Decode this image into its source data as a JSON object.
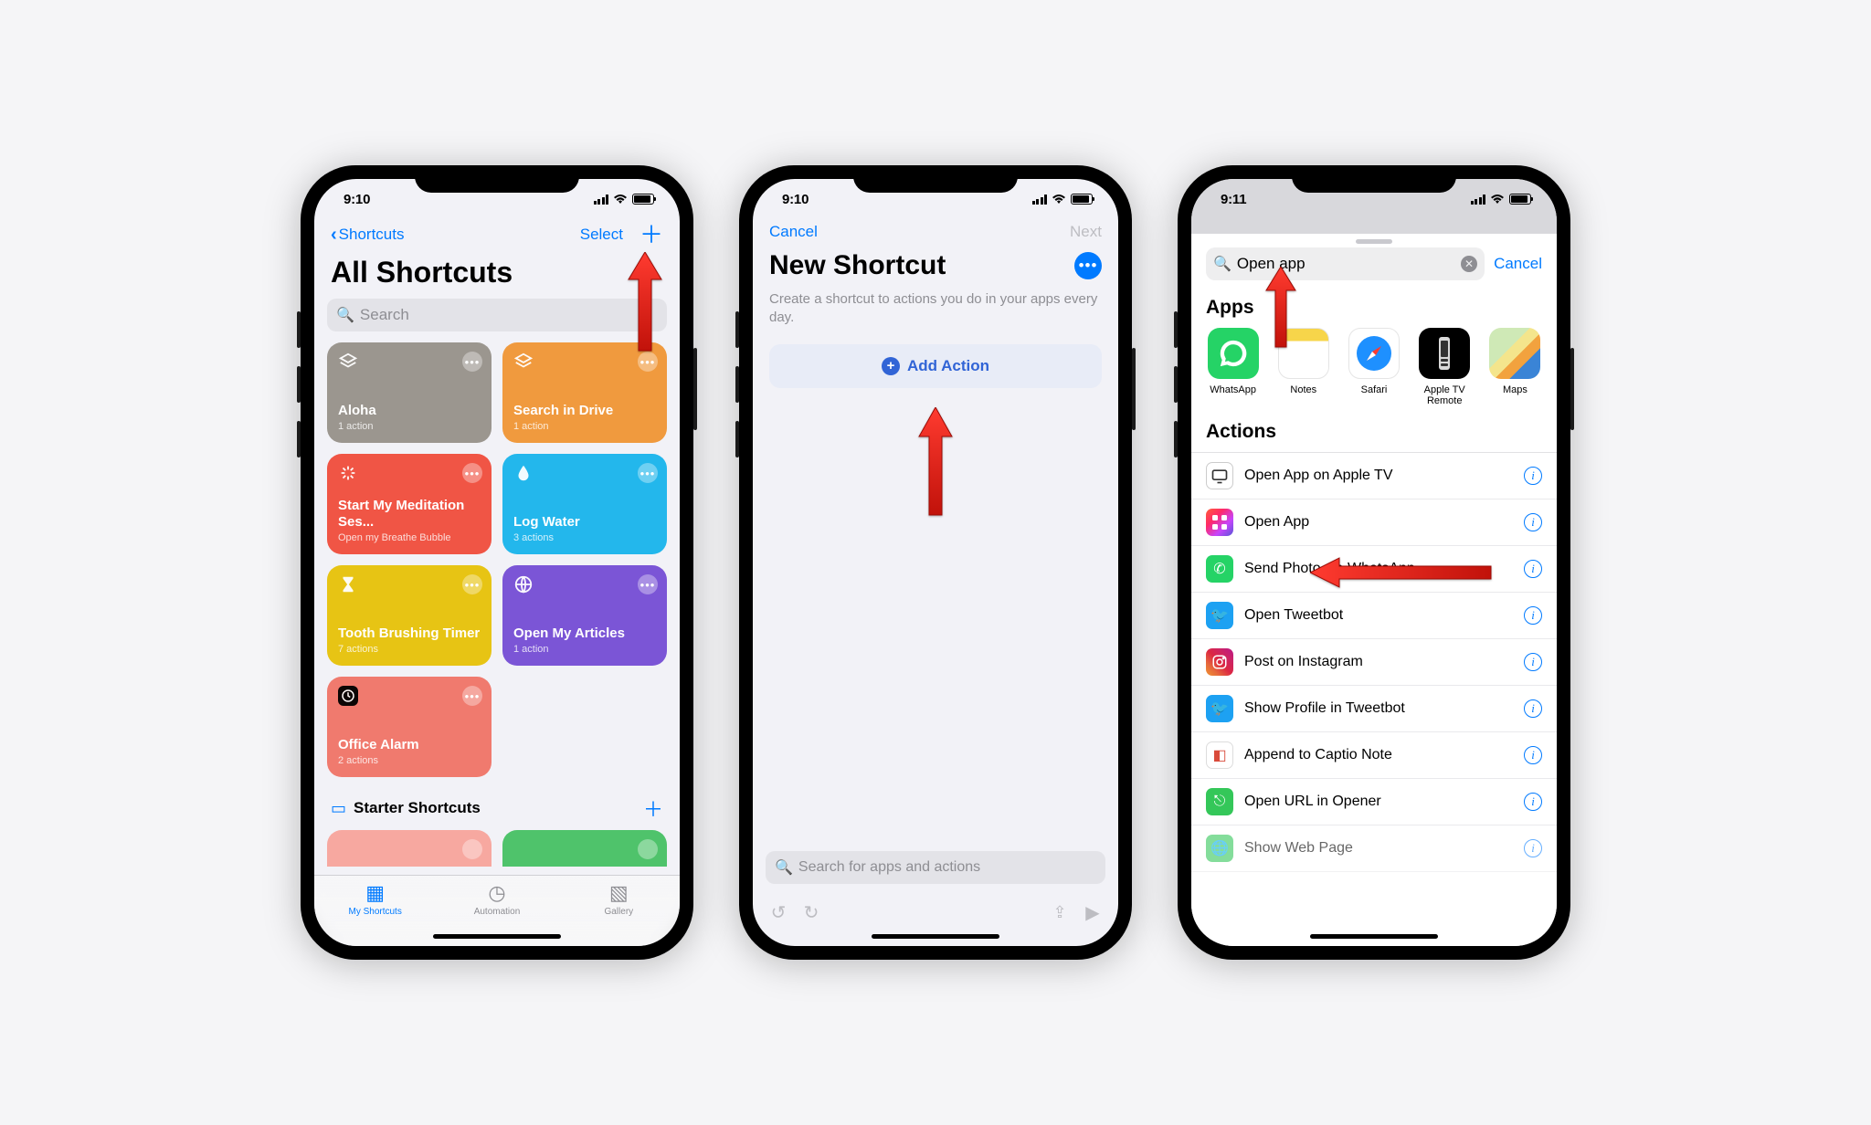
{
  "screen1": {
    "time": "9:10",
    "back_label": "Shortcuts",
    "select_label": "Select",
    "title": "All Shortcuts",
    "search_placeholder": "Search",
    "tiles": {
      "t1_label": "Aloha",
      "t1_sub": "1 action",
      "t2_label": "Search in Drive",
      "t2_sub": "1 action",
      "t3_label": "Start My Meditation Ses...",
      "t3_sub": "Open my Breathe Bubble",
      "t4_label": "Log Water",
      "t4_sub": "3 actions",
      "t5_label": "Tooth Brushing Timer",
      "t5_sub": "7 actions",
      "t6_label": "Open My Articles",
      "t6_sub": "1 action",
      "t7_label": "Office Alarm",
      "t7_sub": "2 actions"
    },
    "starter_label": "Starter Shortcuts",
    "tabs": {
      "a": "My Shortcuts",
      "b": "Automation",
      "c": "Gallery"
    }
  },
  "screen2": {
    "time": "9:10",
    "cancel": "Cancel",
    "next": "Next",
    "title": "New Shortcut",
    "subtext": "Create a shortcut to actions you do in your apps every day.",
    "add_action": "Add Action",
    "search_placeholder": "Search for apps and actions"
  },
  "screen3": {
    "time": "9:11",
    "search_value": "Open app",
    "cancel": "Cancel",
    "apps_header": "Apps",
    "apps": {
      "a": "WhatsApp",
      "b": "Notes",
      "c": "Safari",
      "d": "Apple TV Remote",
      "e": "Maps"
    },
    "actions_header": "Actions",
    "actions": {
      "a": "Open App on Apple TV",
      "b": "Open App",
      "c": "Send Photo via WhatsApp",
      "d": "Open Tweetbot",
      "e": "Post on Instagram",
      "f": "Show Profile in Tweetbot",
      "g": "Append to Captio Note",
      "h": "Open URL in Opener",
      "i": "Show Web Page"
    }
  }
}
